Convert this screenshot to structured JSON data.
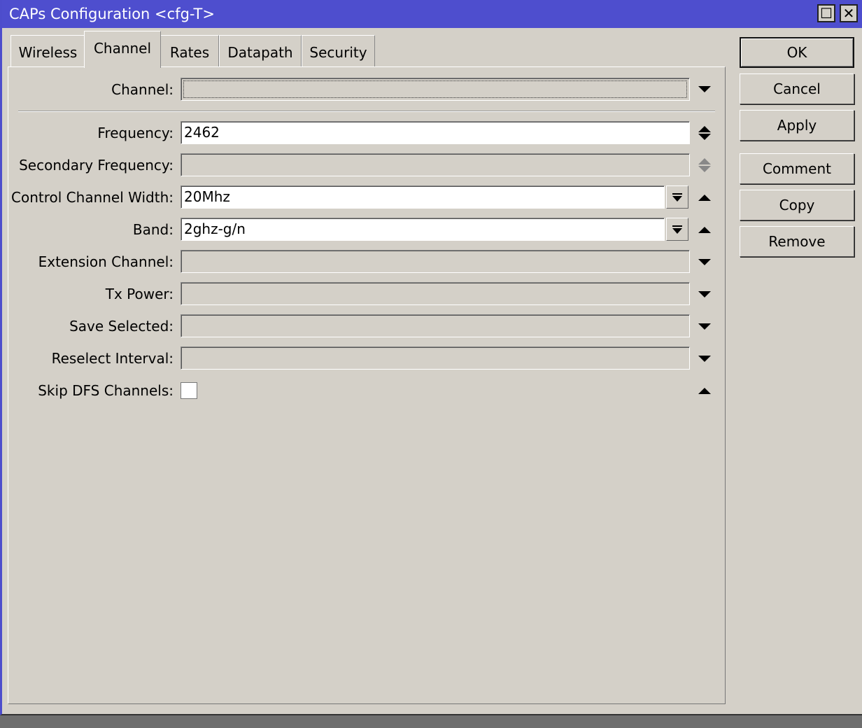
{
  "window": {
    "title": "CAPs Configuration <cfg-T>",
    "maximize_glyph": "☐",
    "close_glyph": "✕"
  },
  "tabs": [
    {
      "label": "Wireless",
      "active": false
    },
    {
      "label": "Channel",
      "active": true
    },
    {
      "label": "Rates",
      "active": false
    },
    {
      "label": "Datapath",
      "active": false
    },
    {
      "label": "Security",
      "active": false
    }
  ],
  "form": {
    "channel": {
      "label": "Channel:",
      "value": ""
    },
    "frequency": {
      "label": "Frequency:",
      "value": "2462"
    },
    "secondary_frequency": {
      "label": "Secondary Frequency:",
      "value": ""
    },
    "control_channel_width": {
      "label": "Control Channel Width:",
      "value": "20Mhz"
    },
    "band": {
      "label": "Band:",
      "value": "2ghz-g/n"
    },
    "extension_channel": {
      "label": "Extension Channel:",
      "value": ""
    },
    "tx_power": {
      "label": "Tx Power:",
      "value": ""
    },
    "save_selected": {
      "label": "Save Selected:",
      "value": ""
    },
    "reselect_interval": {
      "label": "Reselect Interval:",
      "value": ""
    },
    "skip_dfs_channels": {
      "label": "Skip DFS Channels:",
      "checked": false
    }
  },
  "buttons": {
    "ok": "OK",
    "cancel": "Cancel",
    "apply": "Apply",
    "comment": "Comment",
    "copy": "Copy",
    "remove": "Remove"
  }
}
